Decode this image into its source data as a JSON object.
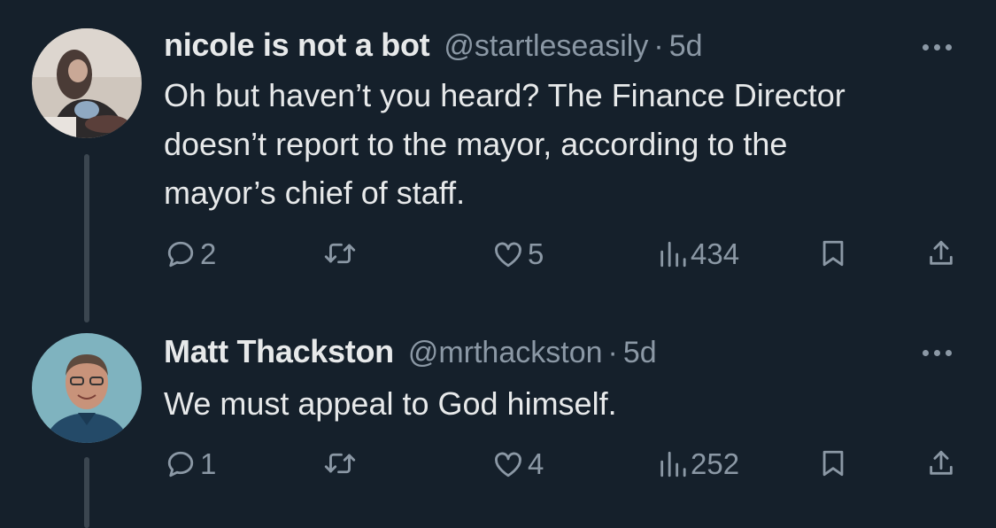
{
  "tweets": [
    {
      "name": "nicole is not a bot",
      "handle": "@startleseasily",
      "separator": "·",
      "time": "5d",
      "text": "Oh but haven’t you heard? The Finance Director doesn’t report to the mayor, according to the mayor’s chief of staff.",
      "replies": "2",
      "likes": "5",
      "views": "434"
    },
    {
      "name": "Matt Thackston",
      "handle": "@mrthackston",
      "separator": "·",
      "time": "5d",
      "text": "We must appeal to God himself.",
      "replies": "1",
      "likes": "4",
      "views": "252"
    }
  ],
  "icons": [
    "more-icon",
    "reply-icon",
    "retweet-icon",
    "like-icon",
    "views-icon",
    "bookmark-icon",
    "share-icon"
  ],
  "colors": {
    "background": "#15202b",
    "text": "#e7e9ea",
    "muted": "#8b98a5",
    "thread_line": "#3b4650"
  }
}
